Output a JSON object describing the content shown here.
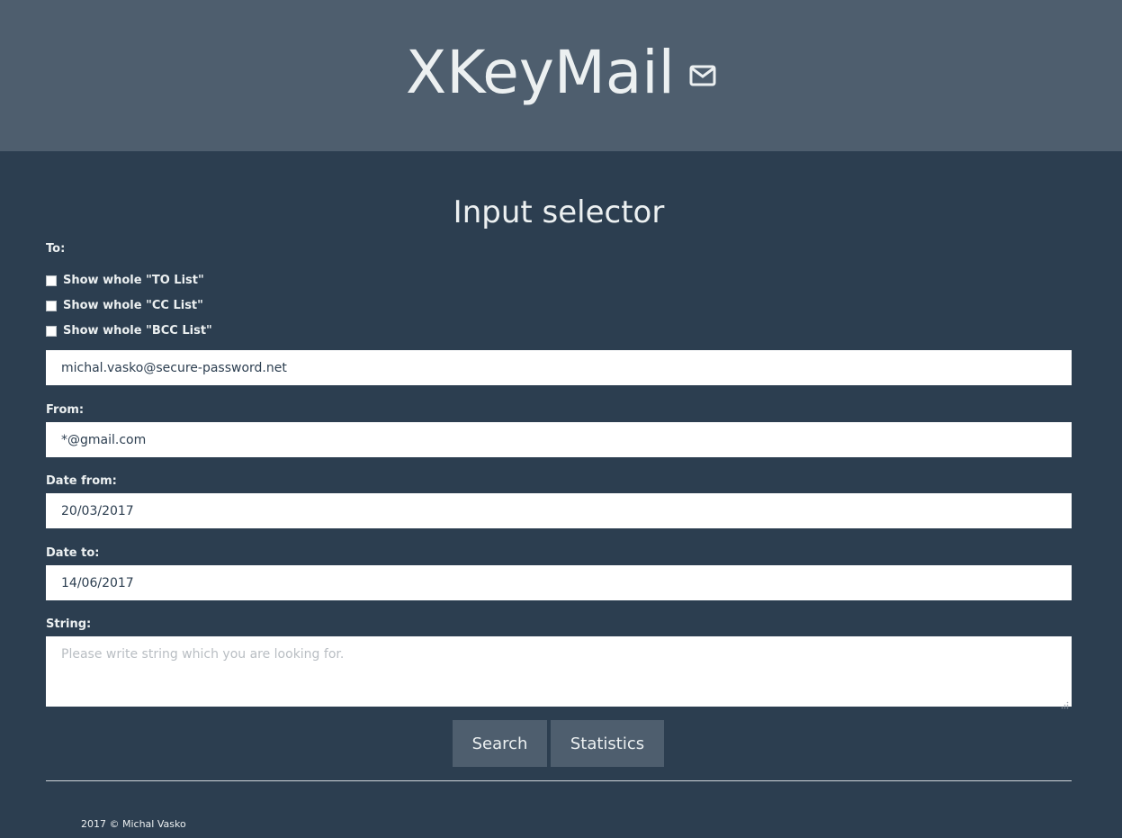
{
  "header": {
    "title": "XKeyMail",
    "icon": "mail-icon"
  },
  "main": {
    "section_title": "Input selector",
    "to": {
      "label": "To:",
      "checkboxes": [
        {
          "label": "Show whole \"TO List\"",
          "checked": false
        },
        {
          "label": "Show whole \"CC List\"",
          "checked": false
        },
        {
          "label": "Show whole \"BCC List\"",
          "checked": false
        }
      ],
      "value": "michal.vasko@secure-password.net"
    },
    "from": {
      "label": "From:",
      "value": "*@gmail.com"
    },
    "date_from": {
      "label": "Date from:",
      "value": "20/03/2017"
    },
    "date_to": {
      "label": "Date to:",
      "value": "14/06/2017"
    },
    "string": {
      "label": "String:",
      "placeholder": "Please write string which you are looking for.",
      "value": ""
    },
    "buttons": {
      "search": "Search",
      "statistics": "Statistics"
    }
  },
  "footer": {
    "text": "2017 © Michal Vasko"
  },
  "colors": {
    "background": "#2c3e50",
    "header": "#4e5e6e",
    "text": "#ecf0f1"
  }
}
